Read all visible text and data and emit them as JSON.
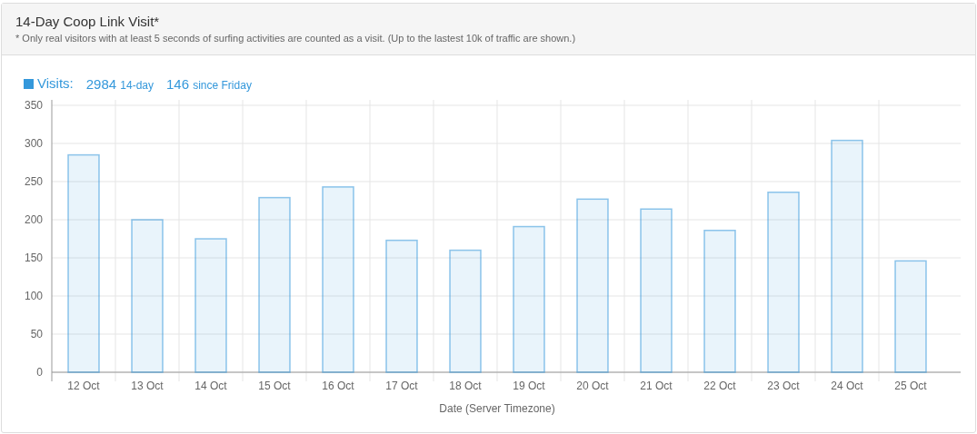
{
  "panel": {
    "title": "14-Day Coop Link Visit*",
    "note": "* Only real visitors with at least 5 seconds of surfing activities are counted as a visit. (Up to the lastest 10k of traffic are shown.)"
  },
  "legend": {
    "label": "Visits:",
    "color": "#3498db",
    "stats": [
      {
        "count": "2984",
        "period": "14-day"
      },
      {
        "count": "146",
        "period": "since Friday"
      }
    ]
  },
  "chart_data": {
    "type": "bar",
    "xlabel": "Date (Server Timezone)",
    "categories": [
      "12 Oct",
      "13 Oct",
      "14 Oct",
      "15 Oct",
      "16 Oct",
      "17 Oct",
      "18 Oct",
      "19 Oct",
      "20 Oct",
      "21 Oct",
      "22 Oct",
      "23 Oct",
      "24 Oct",
      "25 Oct"
    ],
    "grid": true,
    "series": [
      {
        "color": "#3498db",
        "values": [
          285,
          200,
          175,
          229,
          243,
          173,
          160,
          191,
          227,
          214,
          186,
          236,
          304,
          146
        ]
      }
    ],
    "ylim": [
      0,
      350
    ],
    "yticks": [
      0,
      50,
      100,
      150,
      200,
      250,
      300,
      350
    ]
  }
}
